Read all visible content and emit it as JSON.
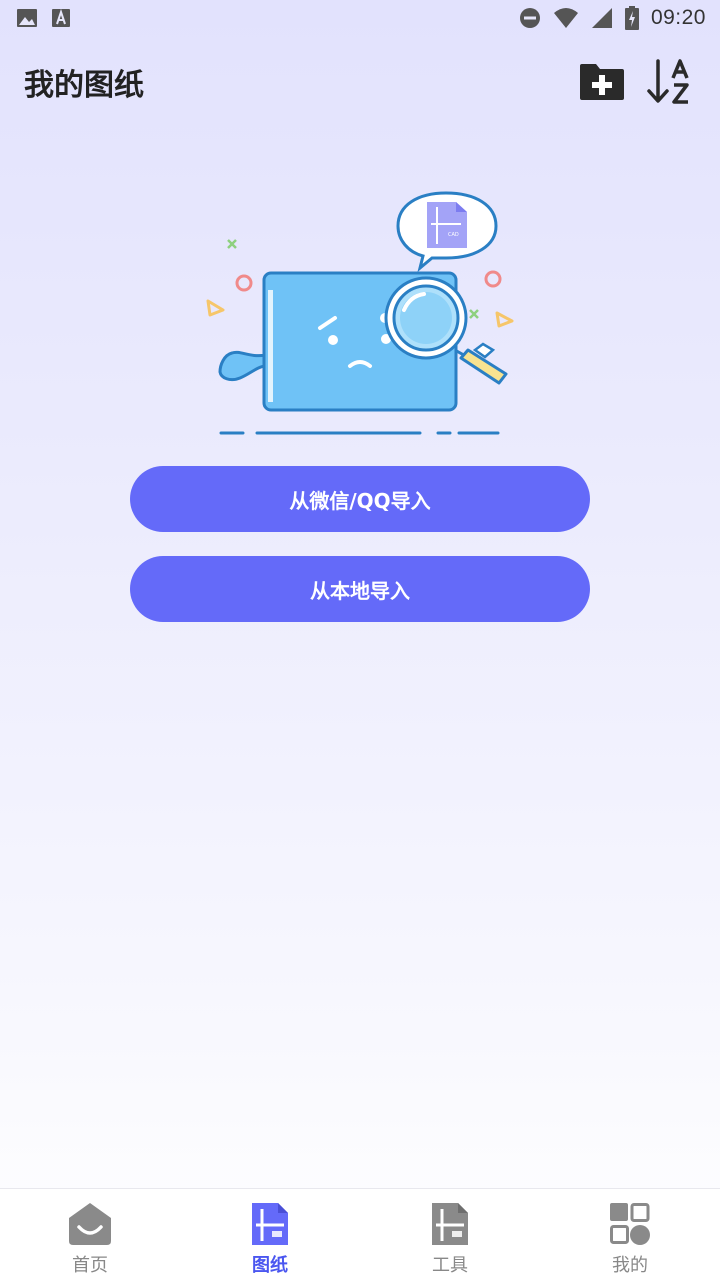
{
  "status_bar": {
    "time": "09:20",
    "left_icons": [
      "image-icon",
      "a-letter-icon"
    ],
    "right_icons": [
      "do-not-disturb-icon",
      "wifi-icon",
      "signal-icon",
      "battery-charging-icon"
    ]
  },
  "header": {
    "title": "我的图纸",
    "actions": [
      "new-folder-icon",
      "sort-az-icon"
    ]
  },
  "illustration": {
    "badge_text": "CAD",
    "name": "empty-state-magnifier-illustration"
  },
  "main": {
    "import_wechat_label": "从微信/QQ导入",
    "import_local_label": "从本地导入"
  },
  "tabbar": {
    "tabs": [
      {
        "label": "首页",
        "icon": "home-icon",
        "active": false
      },
      {
        "label": "图纸",
        "icon": "drawing-icon",
        "active": true
      },
      {
        "label": "工具",
        "icon": "tools-icon",
        "active": false
      },
      {
        "label": "我的",
        "icon": "profile-grid-icon",
        "active": false
      }
    ]
  },
  "colors": {
    "accent": "#646af9",
    "active_tab": "#4a56f0",
    "inactive_tab": "#888888"
  }
}
